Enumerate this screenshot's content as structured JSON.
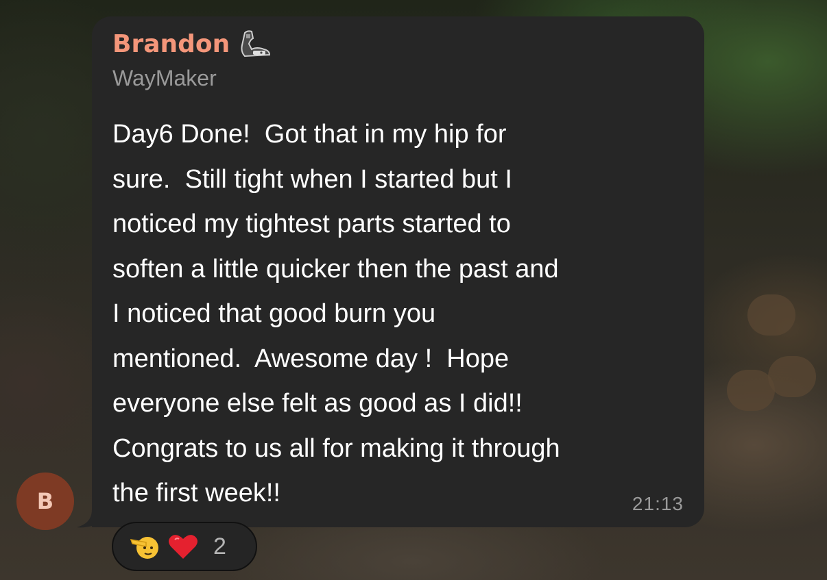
{
  "message": {
    "sender_name": "Brandon",
    "sender_badge_icon": "flexed-biceps-mechanical-arm-icon",
    "sender_title": "WayMaker",
    "text_lines": [
      "Day6 Done!  Got that in my hip for",
      "sure.  Still tight when I started but I",
      "noticed my tightest parts started to",
      "soften a little quicker then the past and",
      "I noticed that good burn you",
      "mentioned.  Awesome day !  Hope",
      "everyone else felt as good as I did!!",
      "Congrats to us all for making it through",
      "the first week!!"
    ],
    "time": "21:13"
  },
  "avatar": {
    "initial": "B",
    "color": "#7e3a24"
  },
  "reactions": {
    "items": [
      {
        "icon": "saluting-face-icon"
      },
      {
        "icon": "red-heart-icon"
      }
    ],
    "count": "2"
  },
  "colors": {
    "bubble": "#262626",
    "sender_name": "#f4967a",
    "secondary_text": "#9a9a9a",
    "message_text": "#ffffff"
  }
}
